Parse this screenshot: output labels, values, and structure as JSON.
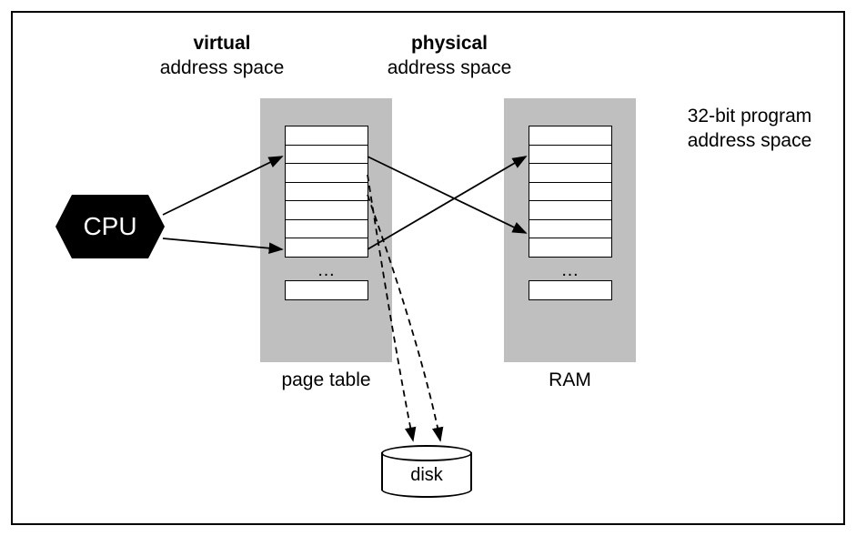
{
  "headings": {
    "virtual_bold": "virtual",
    "virtual_sub": "address space",
    "physical_bold": "physical",
    "physical_sub": "address space"
  },
  "side": {
    "line1": "32-bit program",
    "line2": "address space"
  },
  "cpu_label": "CPU",
  "labels": {
    "page_table": "page table",
    "ram": "RAM",
    "disk": "disk",
    "ellipsis": "…"
  }
}
